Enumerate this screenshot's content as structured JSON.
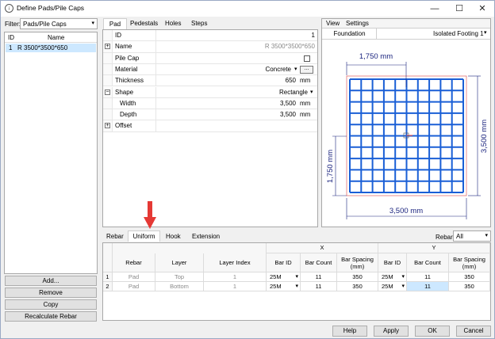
{
  "window": {
    "title": "Define Pads/Pile Caps"
  },
  "filter": {
    "label": "Filter:",
    "value": "Pads/Pile Caps"
  },
  "list": {
    "col_id": "ID",
    "col_name": "Name",
    "items": [
      {
        "id": "1",
        "name": "R 3500*3500*650"
      }
    ]
  },
  "left_buttons": {
    "add": "Add...",
    "remove": "Remove",
    "copy": "Copy",
    "recalculate": "Recalculate Rebar"
  },
  "top_tabs": [
    "Pad",
    "Pedestals",
    "Holes",
    "Steps"
  ],
  "properties": {
    "id_label": "ID",
    "id_value": "1",
    "name_label": "Name",
    "name_value": "R 3500*3500*650",
    "pilecap_label": "Pile Cap",
    "material_label": "Material",
    "material_value": "Concrete",
    "material_more": "...",
    "thickness_label": "Thickness",
    "thickness_value": "650",
    "thickness_unit": "mm",
    "shape_label": "Shape",
    "shape_value": "Rectangle",
    "width_label": "Width",
    "width_value": "3,500",
    "width_unit": "mm",
    "depth_label": "Depth",
    "depth_value": "3,500",
    "depth_unit": "mm",
    "offset_label": "Offset"
  },
  "view_panel": {
    "menu_view": "View",
    "menu_settings": "Settings",
    "tab": "Foundation",
    "selector": "Isolated Footing 1",
    "dim_top": "1,750 mm",
    "dim_right": "3,500 mm",
    "dim_left": "1,750 mm",
    "dim_bottom": "3,500 mm"
  },
  "rebar_tabs": [
    "Rebar",
    "Uniform",
    "Hook",
    "Extension"
  ],
  "rebar_filter": {
    "label": "Rebar:",
    "value": "All"
  },
  "grid": {
    "group_x": "X",
    "group_y": "Y",
    "headers": [
      "Rebar",
      "Layer",
      "Layer Index",
      "Bar ID",
      "Bar Count",
      "Bar Spacing (mm)",
      "Bar ID",
      "Bar Count",
      "Bar Spacing (mm)"
    ],
    "rows": [
      {
        "num": "1",
        "rebar": "Pad",
        "layer": "Top",
        "index": "1",
        "xbar": "25M",
        "xcount": "11",
        "xspacing": "350",
        "ybar": "25M",
        "ycount": "11",
        "yspacing": "350"
      },
      {
        "num": "2",
        "rebar": "Pad",
        "layer": "Bottom",
        "index": "1",
        "xbar": "25M",
        "xcount": "11",
        "xspacing": "350",
        "ybar": "25M",
        "ycount": "11",
        "yspacing": "350"
      }
    ]
  },
  "bottom_buttons": {
    "help": "Help",
    "apply": "Apply",
    "ok": "OK",
    "cancel": "Cancel"
  },
  "colors": {
    "accent": "#1f5fc8",
    "rebar": "#1a5fd6",
    "dim": "#1a237e",
    "arrow": "#e53935",
    "selected": "#cde8ff"
  }
}
